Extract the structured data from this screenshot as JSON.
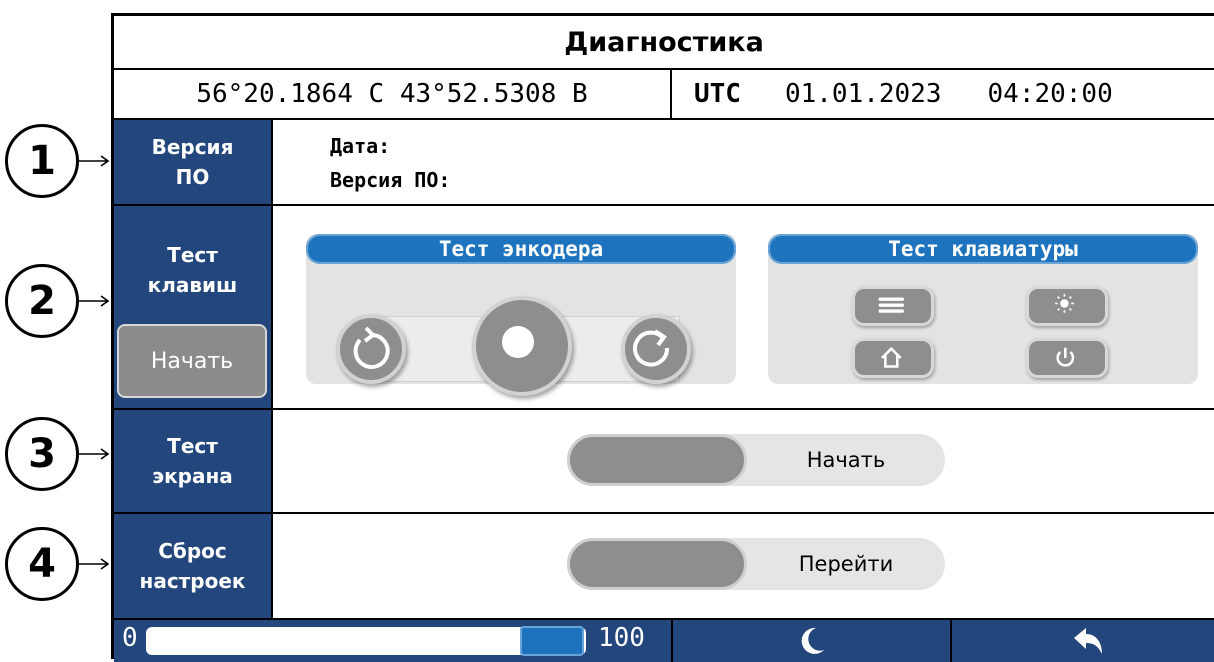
{
  "title": "Диагностика",
  "position": {
    "coords": "56°20.1864 С 43°52.5308 В",
    "utc_label": "UTC",
    "date": "01.01.2023",
    "time": "04:20:00"
  },
  "markers": [
    "1",
    "2",
    "3",
    "4"
  ],
  "sections": {
    "version": {
      "side_label_line1": "Версия",
      "side_label_line2": "ПО",
      "date_label": "Дата:",
      "version_label": "Версия ПО:"
    },
    "keys_test": {
      "side_label_line1": "Тест",
      "side_label_line2": "клавиш",
      "start_button": "Начать",
      "encoder_title": "Тест энкодера",
      "keyboard_title": "Тест клавиатуры",
      "encoder_icons": [
        "rotate-left-icon",
        "encoder-press-icon",
        "rotate-right-icon"
      ],
      "keyboard_icons": [
        "menu-icon",
        "brightness-icon",
        "home-icon",
        "power-icon"
      ]
    },
    "screen_test": {
      "side_label_line1": "Тест",
      "side_label_line2": "экрана",
      "button": "Начать"
    },
    "reset": {
      "side_label_line1": "Сброс",
      "side_label_line2": "настроек",
      "button": "Перейти"
    }
  },
  "status_bar": {
    "slider_min": "0",
    "slider_max": "100",
    "slider_value_fraction": 0.95,
    "night_icon": "moon-icon",
    "back_icon": "back-arrow-icon"
  },
  "colors": {
    "side_panel": "#23467c",
    "accent": "#1e73be",
    "button_gray": "#8e8e8e"
  }
}
